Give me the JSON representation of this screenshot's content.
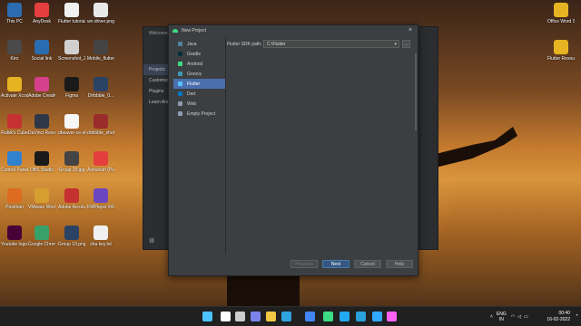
{
  "desktop": {
    "icons_left": [
      {
        "label": "This PC",
        "icon": "computer-icon",
        "color": "#2b6cb0"
      },
      {
        "label": "AnyDesk",
        "icon": "anydesk-icon",
        "color": "#e53e3e"
      },
      {
        "label": "Flutter tutorial",
        "icon": "document-icon",
        "color": "#f0f0f0"
      },
      {
        "label": "wn driver.png",
        "icon": "image-file-icon",
        "color": "#e8e8e8"
      },
      {
        "label": "Kiro",
        "icon": "kiro-icon",
        "color": "#4a4a4a"
      },
      {
        "label": "Social link",
        "icon": "location-icon",
        "color": "#2b6cb0"
      },
      {
        "label": "Screenshot_2...",
        "icon": "image-file-icon",
        "color": "#d0d0d0"
      },
      {
        "label": "Mobile_flutter_2...",
        "icon": "image-file-icon",
        "color": "#444"
      },
      {
        "label": "Activate Xcode",
        "icon": "folder-icon",
        "color": "#e6b422"
      },
      {
        "label": "Adobe Creative...",
        "icon": "creative-cloud-icon",
        "color": "#d53f8c"
      },
      {
        "label": "Figma",
        "icon": "figma-icon",
        "color": "#1a1a1a"
      },
      {
        "label": "Dribbble_0...",
        "icon": "image-file-icon",
        "color": "#2a4365"
      },
      {
        "label": "Rubik's Cube",
        "icon": "cube-icon",
        "color": "#c53030"
      },
      {
        "label": "DaVinci Resolve",
        "icon": "davinci-icon",
        "color": "#2d3748"
      },
      {
        "label": "dbeaver-ce-shortcut",
        "icon": "dbeaver-icon",
        "color": "#f7f7f7"
      },
      {
        "label": "dribbble_shots",
        "icon": "grid-icon",
        "color": "#9b2c2c"
      },
      {
        "label": "Control Panel",
        "icon": "control-panel-icon",
        "color": "#3182ce"
      },
      {
        "label": "OBS Studio",
        "icon": "obs-icon",
        "color": "#1a1a1a"
      },
      {
        "label": "Group 20.jpg",
        "icon": "image-file-icon",
        "color": "#444"
      },
      {
        "label": "Ashutosh (Person 1...",
        "icon": "chrome-icon",
        "color": "#e53e3e"
      },
      {
        "label": "Postman",
        "icon": "postman-icon",
        "color": "#dd6b20"
      },
      {
        "label": "VMware Workstati...",
        "icon": "vmware-icon",
        "color": "#d69e2e"
      },
      {
        "label": "Adobe Acrobat DC",
        "icon": "acrobat-icon",
        "color": "#c53030"
      },
      {
        "label": "KMPlayer 64X",
        "icon": "kmplayer-icon",
        "color": "#6b46c1"
      },
      {
        "label": "Youtube logo.xd",
        "icon": "xd-icon",
        "color": "#470137"
      },
      {
        "label": "Google Chrome",
        "icon": "chrome-icon",
        "color": "#38a169"
      },
      {
        "label": "Group 10.png",
        "icon": "image-file-icon",
        "color": "#2a4365"
      },
      {
        "label": "sha key.txt",
        "icon": "text-file-icon",
        "color": "#f0f0f0"
      }
    ],
    "icons_right": [
      {
        "label": "Office Word Special",
        "icon": "folder-icon",
        "color": "#e6b422"
      },
      {
        "label": "Flutter Resources",
        "icon": "folder-icon",
        "color": "#e6b422"
      }
    ]
  },
  "welcome_window": {
    "title": "Welcome",
    "sidebar": [
      "Projects",
      "Customize",
      "Plugins",
      "Learn Android"
    ],
    "active": "Projects"
  },
  "dialog": {
    "title": "New Project",
    "project_types": [
      {
        "label": "Java",
        "icon": "java-icon",
        "color": "#5382a1"
      },
      {
        "label": "Gradle",
        "icon": "gradle-icon",
        "color": "#02303a"
      },
      {
        "label": "Android",
        "icon": "android-icon",
        "color": "#3ddc84"
      },
      {
        "label": "Groovy",
        "icon": "groovy-icon",
        "color": "#4298b8"
      },
      {
        "label": "Flutter",
        "icon": "flutter-icon",
        "color": "#54c5f8"
      },
      {
        "label": "Dart",
        "icon": "dart-icon",
        "color": "#0175c2"
      },
      {
        "label": "Web",
        "icon": "web-icon",
        "color": "#8e9aaf"
      },
      {
        "label": "Empty Project",
        "icon": "empty-project-icon",
        "color": "#8e9aaf"
      }
    ],
    "selected": "Flutter",
    "sdk_path_label": "Flutter SDK path:",
    "sdk_path_value": "C:\\Flutter",
    "buttons": {
      "previous": "Previous",
      "next": "Next",
      "cancel": "Cancel",
      "help": "Help"
    }
  },
  "taskbar": {
    "apps": [
      {
        "icon": "windows-start-icon",
        "color": "#4cc2ff"
      },
      {
        "icon": "search-icon",
        "color": "#ffffff"
      },
      {
        "icon": "task-view-icon",
        "color": "#cccccc"
      },
      {
        "icon": "teams-chat-icon",
        "color": "#7b83eb"
      },
      {
        "icon": "file-explorer-icon",
        "color": "#f2c744"
      },
      {
        "icon": "edge-icon",
        "color": "#2fa3e0"
      },
      {
        "icon": "chrome-icon",
        "color": "#4285f4"
      },
      {
        "icon": "android-studio-icon",
        "color": "#3ddc84"
      },
      {
        "icon": "vscode-icon",
        "color": "#23a9f2"
      },
      {
        "icon": "telegram-icon",
        "color": "#2aa1da"
      },
      {
        "icon": "photoshop-icon",
        "color": "#31a8ff"
      },
      {
        "icon": "xd-icon",
        "color": "#ff61f6"
      }
    ],
    "tray_language_1": "ENG",
    "tray_language_2": "IN",
    "time": "00:40",
    "date": "16-02-2022"
  }
}
